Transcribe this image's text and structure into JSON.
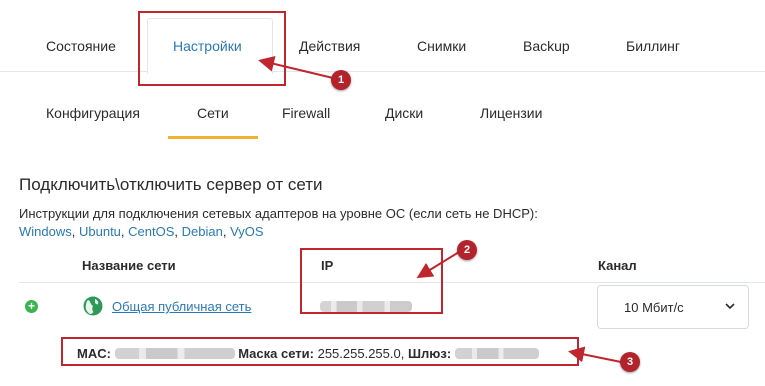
{
  "main_tabs": [
    {
      "label": "Состояние"
    },
    {
      "label": "Настройки"
    },
    {
      "label": "Действия"
    },
    {
      "label": "Снимки"
    },
    {
      "label": "Backup"
    },
    {
      "label": "Биллинг"
    }
  ],
  "sub_tabs": [
    {
      "label": "Конфигурация"
    },
    {
      "label": "Сети"
    },
    {
      "label": "Firewall"
    },
    {
      "label": "Диски"
    },
    {
      "label": "Лицензии"
    }
  ],
  "section": {
    "title": "Подключить\\отключить сервер от сети",
    "instructions": "Инструкции для подключения сетевых адаптеров на уровне ОС (если сеть не DHCP):",
    "os_links": [
      "Windows",
      "Ubuntu",
      "CentOS",
      "Debian",
      "VyOS"
    ]
  },
  "table": {
    "headers": {
      "name": "Название сети",
      "ip": "IP",
      "channel": "Канал"
    },
    "row": {
      "name": "Общая публичная сеть",
      "channel_value": "10 Мбит/с",
      "mac_label": "MAC:",
      "mask_label": "Маска сети:",
      "mask_value": "255.255.255.0,",
      "gateway_label": "Шлюз:"
    }
  },
  "annotations": [
    {
      "number": "1"
    },
    {
      "number": "2"
    },
    {
      "number": "3"
    }
  ],
  "colors": {
    "accent": "#2a7ab8",
    "underline": "#f0b331",
    "annotation": "#c0262d",
    "plus": "#3cb353",
    "globe": "#2e9a57"
  }
}
